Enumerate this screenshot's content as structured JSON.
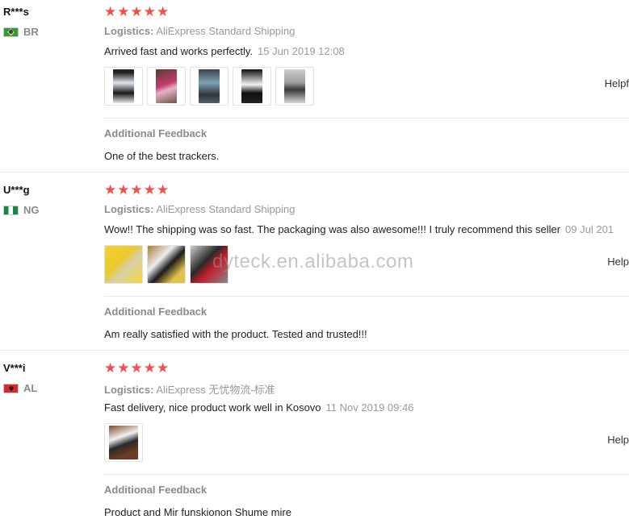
{
  "reviews": [
    {
      "user": "R***s",
      "country": "BR",
      "stars": "★★★★★",
      "logistics_label": "Logistics:",
      "logistics_value": "AliExpress Standard Shipping",
      "comment": "Arrived fast and works perfectly.",
      "date": "15 Jun 2019 12:08",
      "helpful": "Helpf",
      "additional_label": "Additional Feedback",
      "additional_text": "One of the best trackers."
    },
    {
      "user": "U***g",
      "country": "NG",
      "stars": "★★★★★",
      "logistics_label": "Logistics:",
      "logistics_value": "AliExpress Standard Shipping",
      "comment": "Wow!! The shipping was so fast. The packaging was also awesome!!! I truly recommend this seller",
      "date": "09 Jul 201",
      "helpful": "Help",
      "additional_label": "Additional Feedback",
      "additional_text": "Am really satisfied with the product. Tested and trusted!!!"
    },
    {
      "user": "V***i",
      "country": "AL",
      "stars": "★★★★★",
      "logistics_label": "Logistics:",
      "logistics_value": "AliExpress 无忧物流-标准",
      "comment": "Fast delivery, nice product work well in Kosovo",
      "date": "11 Nov 2019 09:46",
      "helpful": "Help",
      "additional_label": "Additional Feedback",
      "additional_text": "Product and Mir funskionon Shume mire"
    }
  ],
  "watermark": "dyteck.en.alibaba.com",
  "colors": {
    "star": "#f24f49",
    "muted": "#999999",
    "divider": "#e9e9e9"
  }
}
